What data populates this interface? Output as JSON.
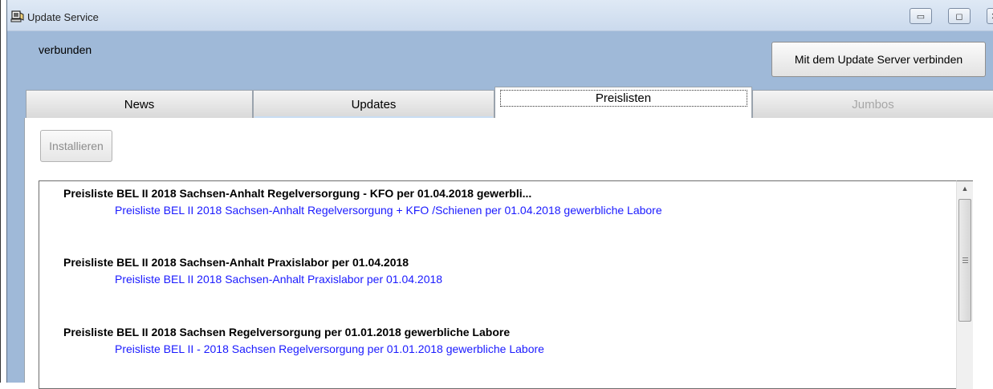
{
  "window": {
    "title": "Update Service",
    "controls": {
      "minimize": "▭",
      "maximize": "◻",
      "close": "✕"
    }
  },
  "status_text": "verbunden",
  "connect_button": "Mit dem Update Server verbinden",
  "tabs": [
    {
      "label": "News",
      "state": "normal"
    },
    {
      "label": "Updates",
      "state": "normal"
    },
    {
      "label": "Preislisten",
      "state": "selected"
    },
    {
      "label": "Jumbos",
      "state": "disabled"
    }
  ],
  "install_button": "Installieren",
  "price_lists": [
    {
      "title": "Preisliste BEL II 2018 Sachsen-Anhalt Regelversorgung  - KFO per 01.04.2018 gewerbli...",
      "description": "Preisliste BEL II 2018 Sachsen-Anhalt Regelversorgung + KFO /Schienen  per 01.04.2018 gewerbliche Labore"
    },
    {
      "title": "Preisliste BEL II 2018 Sachsen-Anhalt Praxislabor per 01.04.2018",
      "description": "Preisliste BEL II 2018 Sachsen-Anhalt Praxislabor per 01.04.2018"
    },
    {
      "title": "Preisliste BEL II 2018 Sachsen Regelversorgung per 01.01.2018 gewerbliche Labore",
      "description": "Preisliste BEL II  - 2018 Sachsen Regelversorgung per 01.01.2018 gewerbliche Labore"
    }
  ],
  "colors": {
    "window_background": "#9fb9d8",
    "link_blue": "#1a1aff",
    "disabled_text": "#a7a7a7"
  },
  "icons": {
    "app": "app-icon",
    "scroll_up": "scroll-up-arrow-icon",
    "scroll_grip": "scroll-grip-icon"
  }
}
